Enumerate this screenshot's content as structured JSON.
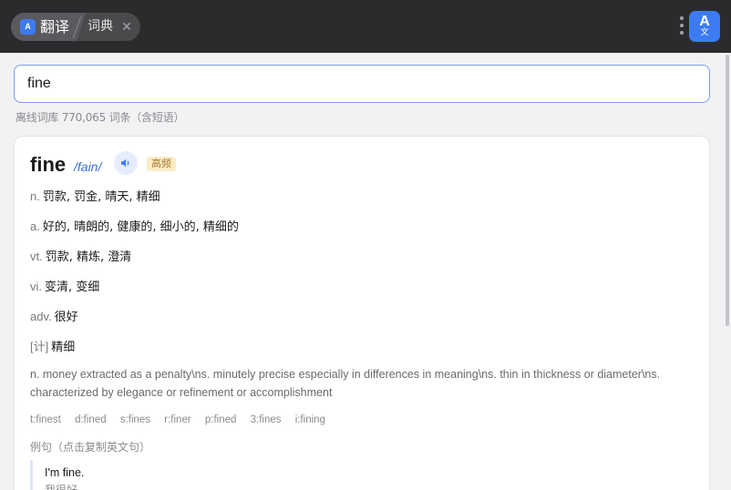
{
  "app": {
    "tabs": [
      {
        "label": "翻译",
        "active": true,
        "icon": "translate-icon"
      },
      {
        "label": "词典",
        "active": false
      }
    ],
    "close_glyph": "✕",
    "logo": {
      "big": "A",
      "small": "文"
    },
    "accent_color": "#3d7bf5"
  },
  "search": {
    "value": "fine",
    "placeholder": ""
  },
  "dict_info": "离线词库 770,065 词条（含短语）",
  "entry": {
    "word": "fine",
    "phonetic": "/fain/",
    "badge": "高频",
    "definitions": [
      {
        "pos": "n.",
        "text": "罚款, 罚金, 晴天, 精细"
      },
      {
        "pos": "a.",
        "text": "好的, 晴朗的, 健康的, 细小的, 精细的"
      },
      {
        "pos": "vt.",
        "text": "罚款, 精炼, 澄清"
      },
      {
        "pos": "vi.",
        "text": "变清, 变细"
      },
      {
        "pos": "adv.",
        "text": "很好"
      },
      {
        "pos": "[计]",
        "text": "精细"
      }
    ],
    "english_definition": "n. money extracted as a penalty\\ns. minutely precise especially in differences in meaning\\ns. thin in thickness or diameter\\ns. characterized by elegance or refinement or accomplishment",
    "forms": [
      "t:finest",
      "d:fined",
      "s:fines",
      "r:finer",
      "p:fined",
      "3:fines",
      "i:fining"
    ],
    "examples_label": "例句（点击复制英文句）",
    "examples": [
      {
        "en": "I'm fine.",
        "zh": "我很好。"
      }
    ]
  }
}
